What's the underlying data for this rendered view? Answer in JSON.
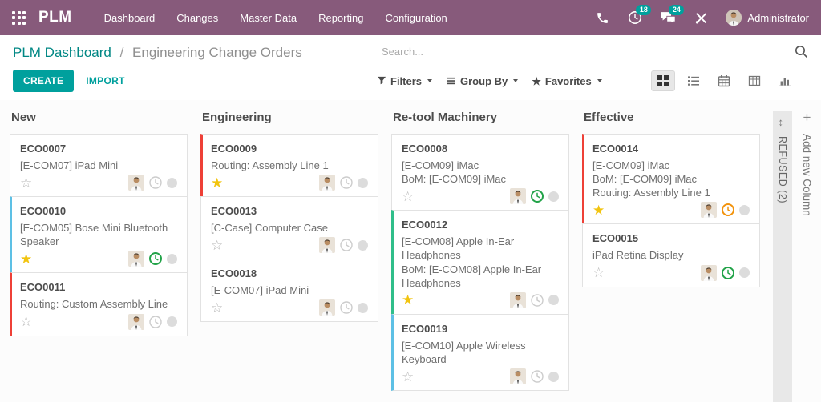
{
  "navbar": {
    "brand": "PLM",
    "menu_items": [
      "Dashboard",
      "Changes",
      "Master Data",
      "Reporting",
      "Configuration"
    ],
    "systray": {
      "activities_badge": "18",
      "messages_badge": "24",
      "user_name": "Administrator"
    }
  },
  "breadcrumb": {
    "parent": "PLM Dashboard",
    "separator": "/",
    "current": "Engineering Change Orders"
  },
  "search": {
    "placeholder": "Search..."
  },
  "actions": {
    "create_label": "CREATE",
    "import_label": "IMPORT"
  },
  "controls": {
    "filters_label": "Filters",
    "group_by_label": "Group By",
    "favorites_label": "Favorites"
  },
  "view_switcher": [
    "kanban",
    "list",
    "calendar",
    "pivot",
    "graph"
  ],
  "icons": {
    "star_filled": "★",
    "star_empty": "☆",
    "favorites_star": "★",
    "plus": "+",
    "expand_arrows": "↔"
  },
  "colors": {
    "nav_background": "#875a7b",
    "primary": "#00a09d",
    "link": "#008784",
    "badge": "#00a09d",
    "star_on": "#f2c40f",
    "star_off": "#b9b9b9",
    "clock_gray": "#cccccc",
    "clock_green": "#22a349",
    "clock_orange": "#f2930d",
    "state_dot": "#dcdcdc",
    "card_accents": {
      "red": "#ee4037",
      "blue": "#5dc0e5",
      "green": "#2fbe8a"
    }
  },
  "board": {
    "columns": [
      {
        "title": "New",
        "cards": [
          {
            "id": "ECO0007",
            "lines": [
              "[E-COM07] iPad Mini"
            ],
            "accent": "",
            "starred": false,
            "clock": "gray"
          },
          {
            "id": "ECO0010",
            "lines": [
              "[E-COM05] Bose Mini Bluetooth Speaker"
            ],
            "accent": "blue",
            "starred": true,
            "clock": "green"
          },
          {
            "id": "ECO0011",
            "lines": [
              "Routing: Custom Assembly Line"
            ],
            "accent": "red",
            "starred": false,
            "clock": "gray"
          }
        ]
      },
      {
        "title": "Engineering",
        "cards": [
          {
            "id": "ECO0009",
            "lines": [
              "Routing: Assembly Line 1"
            ],
            "accent": "red",
            "starred": true,
            "clock": "gray"
          },
          {
            "id": "ECO0013",
            "lines": [
              "[C-Case] Computer Case"
            ],
            "accent": "",
            "starred": false,
            "clock": "gray"
          },
          {
            "id": "ECO0018",
            "lines": [
              "[E-COM07] iPad Mini"
            ],
            "accent": "",
            "starred": false,
            "clock": "gray"
          }
        ]
      },
      {
        "title": "Re-tool Machinery",
        "cards": [
          {
            "id": "ECO0008",
            "lines": [
              "[E-COM09] iMac",
              "BoM: [E-COM09] iMac"
            ],
            "accent": "",
            "starred": false,
            "clock": "green"
          },
          {
            "id": "ECO0012",
            "lines": [
              "[E-COM08] Apple In-Ear Headphones",
              "BoM: [E-COM08] Apple In-Ear Headphones"
            ],
            "accent": "green",
            "starred": true,
            "clock": "gray"
          },
          {
            "id": "ECO0019",
            "lines": [
              "[E-COM10] Apple Wireless Keyboard"
            ],
            "accent": "blue",
            "starred": false,
            "clock": "gray"
          }
        ]
      },
      {
        "title": "Effective",
        "cards": [
          {
            "id": "ECO0014",
            "lines": [
              "[E-COM09] iMac",
              "BoM: [E-COM09] iMac",
              "Routing: Assembly Line 1"
            ],
            "accent": "red",
            "starred": true,
            "clock": "orange"
          },
          {
            "id": "ECO0015",
            "lines": [
              "iPad Retina Display"
            ],
            "accent": "",
            "starred": false,
            "clock": "green"
          }
        ]
      }
    ],
    "collapsed_column": {
      "label": "REFUSED (2)"
    },
    "add_column": {
      "label": "Add new Column"
    }
  }
}
